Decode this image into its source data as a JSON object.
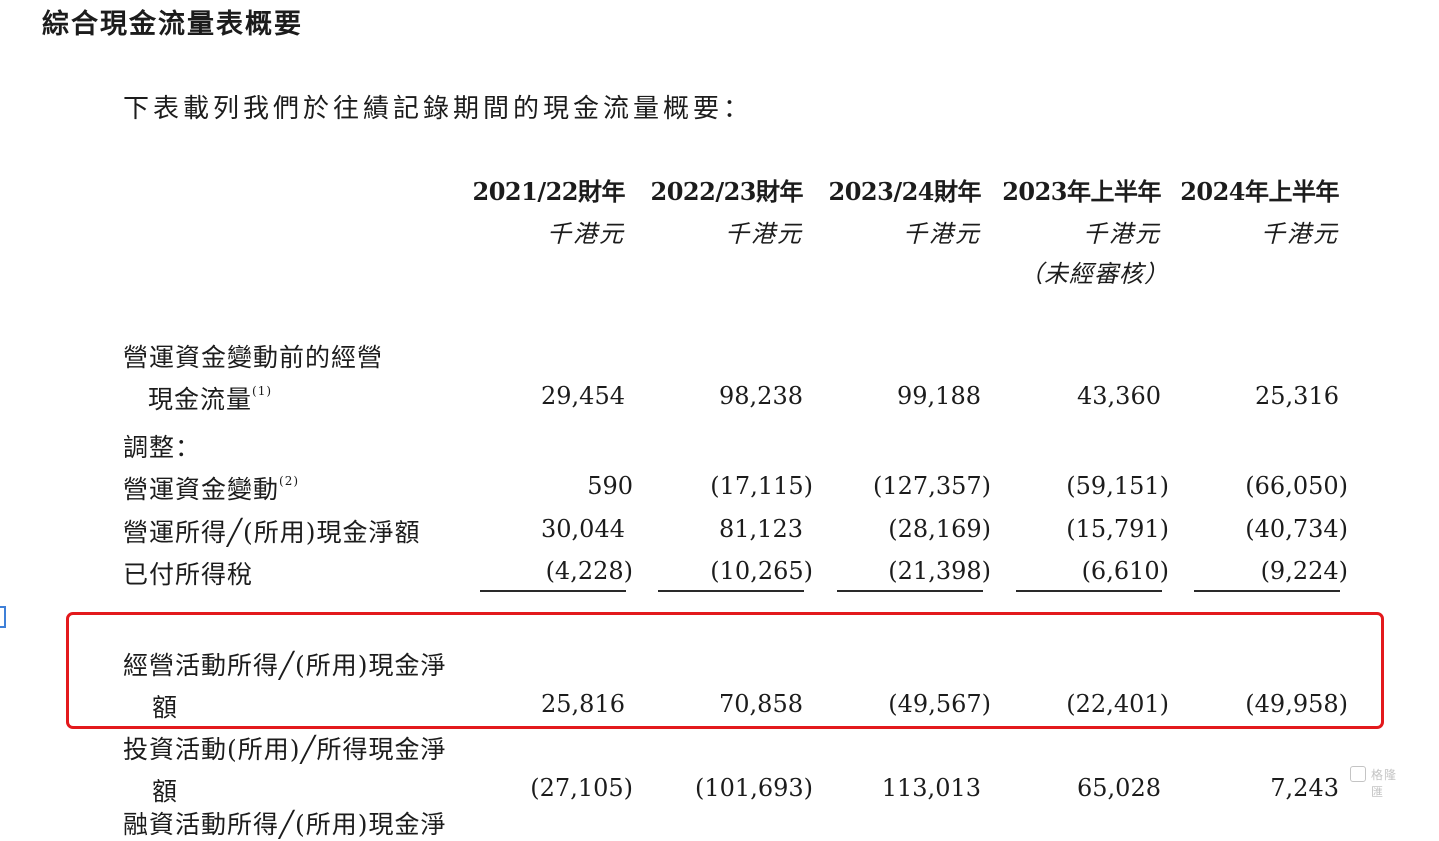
{
  "title": "綜合現金流量表概要",
  "intro": "下表載列我們於往績記錄期間的現金流量概要：",
  "columns": [
    {
      "period": "2021/22財年",
      "unit": "千港元",
      "note": ""
    },
    {
      "period": "2022/23財年",
      "unit": "千港元",
      "note": ""
    },
    {
      "period": "2023/24財年",
      "unit": "千港元",
      "note": ""
    },
    {
      "period": "2023年上半年",
      "unit": "千港元",
      "note": "（未經審核）"
    },
    {
      "period": "2024年上半年",
      "unit": "千港元",
      "note": ""
    }
  ],
  "rows": {
    "op_before_wc": {
      "label_line1": "營運資金變動前的經營",
      "label_line2": "現金流量",
      "footnote": "(1)",
      "values": [
        "29,454",
        "98,238",
        "99,188",
        "43,360",
        "25,316"
      ]
    },
    "adjustments": {
      "label": "調整："
    },
    "wc_changes": {
      "label": "營運資金變動",
      "footnote": "(2)",
      "values": [
        "590",
        "(17,115)",
        "(127,357)",
        "(59,151)",
        "(66,050)"
      ]
    },
    "op_generated": {
      "label": "營運所得╱(所用)現金淨額",
      "values": [
        "30,044",
        "81,123",
        "(28,169)",
        "(15,791)",
        "(40,734)"
      ]
    },
    "tax_paid": {
      "label": "已付所得稅",
      "values": [
        "(4,228)",
        "(10,265)",
        "(21,398)",
        "(6,610)",
        "(9,224)"
      ]
    },
    "net_operating": {
      "label_line1": "經營活動所得╱(所用)現金淨",
      "label_line2": "額",
      "values": [
        "25,816",
        "70,858",
        "(49,567)",
        "(22,401)",
        "(49,958)"
      ]
    },
    "net_investing": {
      "label_line1": "投資活動(所用)╱所得現金淨",
      "label_line2": "額",
      "values": [
        "(27,105)",
        "(101,693)",
        "113,013",
        "65,028",
        "7,243"
      ]
    },
    "partial_next": {
      "label": "融資活動所得╱(所用)現金淨"
    }
  },
  "watermark": "格隆匯",
  "colors": {
    "highlight": "#e3191c",
    "text": "#1c1c1c",
    "side_mark": "#3f80d8"
  }
}
